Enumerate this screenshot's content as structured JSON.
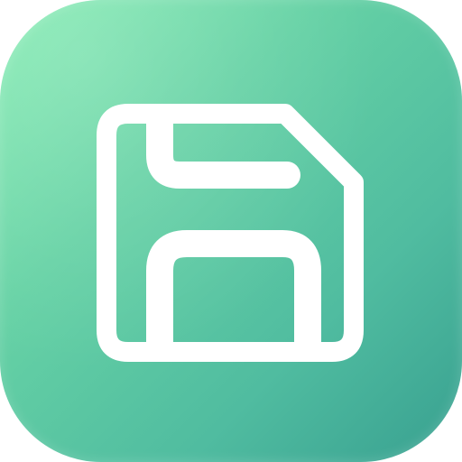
{
  "icon": {
    "name": "save-icon",
    "glyph": "floppy-disk",
    "background_gradient": [
      "#84ECB2",
      "#66D2A5",
      "#50BCA0",
      "#38A090"
    ],
    "foreground_color": "#FFFFFF"
  }
}
